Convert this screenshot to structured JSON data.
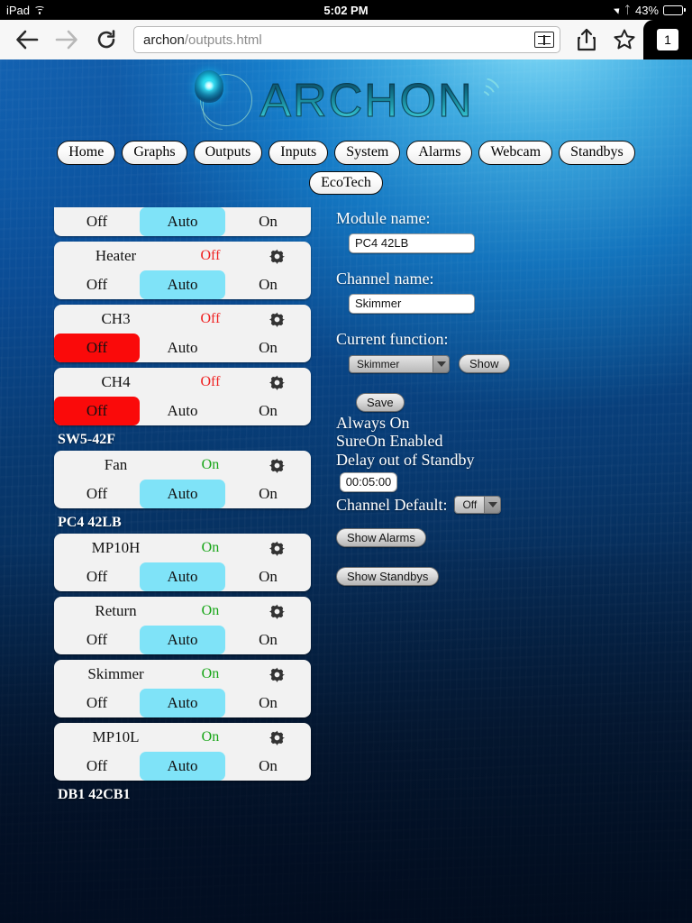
{
  "status_bar": {
    "device": "iPad",
    "wifi_icon": "wifi-icon",
    "time": "5:02 PM",
    "location_icon": "location-arrow-icon",
    "bluetooth_icon": "bluetooth-icon",
    "battery_percent": "43%"
  },
  "browser": {
    "back_icon": "back-arrow-icon",
    "forward_icon": "forward-arrow-icon",
    "reload_icon": "reload-icon",
    "url_host": "archon",
    "url_path": "/outputs.html",
    "reader_icon": "reader-view-icon",
    "share_icon": "share-icon",
    "bookmark_icon": "star-icon",
    "tab_count": "1"
  },
  "header": {
    "logo_text": "ARCHON",
    "logo_mark": "archon-orb-icon",
    "logo_waves": "signal-waves-icon"
  },
  "nav": {
    "row1": [
      "Home",
      "Graphs",
      "Outputs",
      "Inputs",
      "System",
      "Alarms",
      "Webcam",
      "Standbys"
    ],
    "row2": [
      "EcoTech"
    ]
  },
  "segment_labels": {
    "off": "Off",
    "auto": "Auto",
    "on": "On"
  },
  "outputs": [
    {
      "type": "card",
      "clipped_top": true,
      "name": "",
      "status": "",
      "status_state": "",
      "selected": "auto"
    },
    {
      "type": "card",
      "clipped_top": false,
      "name": "Heater",
      "status": "Off",
      "status_state": "off",
      "selected": "auto"
    },
    {
      "type": "card",
      "clipped_top": false,
      "name": "CH3",
      "status": "Off",
      "status_state": "off",
      "selected": "off"
    },
    {
      "type": "card",
      "clipped_top": false,
      "name": "CH4",
      "status": "Off",
      "status_state": "off",
      "selected": "off"
    },
    {
      "type": "group",
      "label": "SW5-42F"
    },
    {
      "type": "card",
      "clipped_top": false,
      "name": "Fan",
      "status": "On",
      "status_state": "on",
      "selected": "auto"
    },
    {
      "type": "group",
      "label": "PC4 42LB"
    },
    {
      "type": "card",
      "clipped_top": false,
      "name": "MP10H",
      "status": "On",
      "status_state": "on",
      "selected": "auto"
    },
    {
      "type": "card",
      "clipped_top": false,
      "name": "Return",
      "status": "On",
      "status_state": "on",
      "selected": "auto"
    },
    {
      "type": "card",
      "clipped_top": false,
      "name": "Skimmer",
      "status": "On",
      "status_state": "on",
      "selected": "auto"
    },
    {
      "type": "card",
      "clipped_top": false,
      "name": "MP10L",
      "status": "On",
      "status_state": "on",
      "selected": "auto"
    },
    {
      "type": "group",
      "label": "DB1 42CB1"
    }
  ],
  "panel": {
    "module_name_label": "Module name:",
    "module_name_value": "PC4 42LB",
    "channel_name_label": "Channel name:",
    "channel_name_value": "Skimmer",
    "current_function_label": "Current function:",
    "current_function_value": "Skimmer",
    "show_button": "Show",
    "save_button": "Save",
    "always_on": "Always On",
    "sureon": "SureOn Enabled",
    "delay_label": "Delay out of Standby",
    "delay_value": "00:05:00",
    "channel_default_label": "Channel Default:",
    "channel_default_value": "Off",
    "show_alarms_button": "Show Alarms",
    "show_standbys_button": "Show Standbys",
    "gear_icon": "gear-icon",
    "dropdown_icon": "chevron-down-icon"
  },
  "colors": {
    "auto_highlight": "#7fe3f8",
    "off_highlight": "#fa0a0a",
    "status_on": "#16a516",
    "status_off": "#ef2020"
  }
}
